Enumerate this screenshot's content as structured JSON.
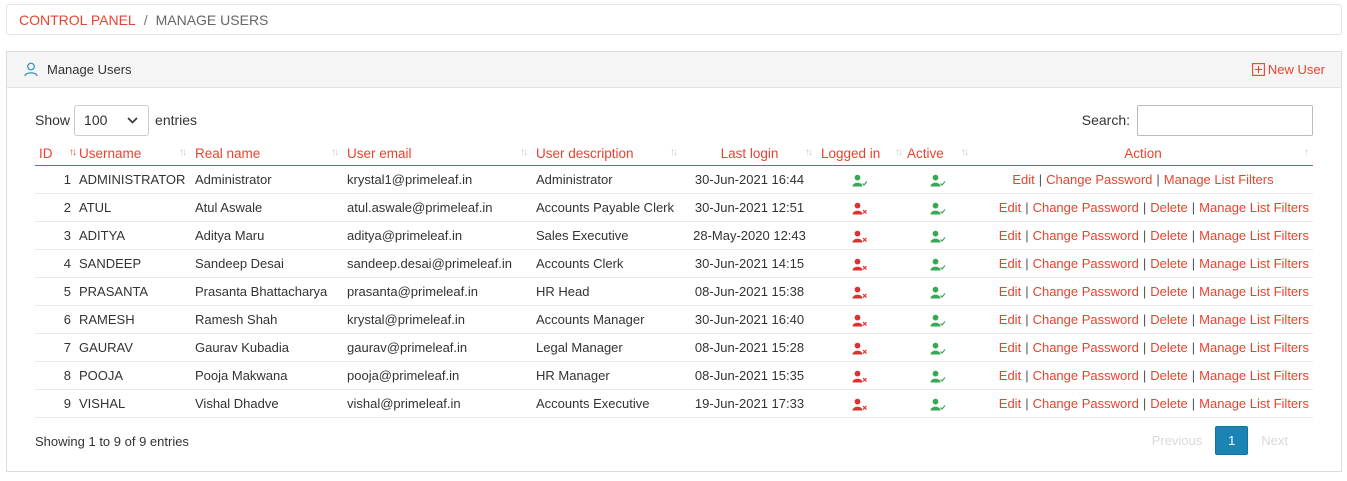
{
  "breadcrumb": {
    "root": "CONTROL PANEL",
    "separator": "/",
    "current": "MANAGE USERS"
  },
  "panel": {
    "title": "Manage Users",
    "new_user": "New User"
  },
  "controls": {
    "show": "Show",
    "entries_value": "100",
    "entries": "entries",
    "search": "Search:"
  },
  "columns": [
    "ID",
    "Username",
    "Real name",
    "User email",
    "User description",
    "Last login",
    "Logged in",
    "Active",
    "Action"
  ],
  "actions": {
    "edit": "Edit",
    "change_password": "Change Password",
    "delete": "Delete",
    "filters": "Manage List Filters",
    "sep": "|"
  },
  "rows": [
    {
      "id": "1",
      "username": "ADMINISTRATOR",
      "real_name": "Administrator",
      "email": "krystal1@primeleaf.in",
      "description": "Administrator",
      "last_login": "30-Jun-2021 16:44",
      "logged_in": true,
      "active": true
    },
    {
      "id": "2",
      "username": "ATUL",
      "real_name": "Atul Aswale",
      "email": "atul.aswale@primeleaf.in",
      "description": "Accounts Payable Clerk",
      "last_login": "30-Jun-2021 12:51",
      "logged_in": false,
      "active": true
    },
    {
      "id": "3",
      "username": "ADITYA",
      "real_name": "Aditya Maru",
      "email": "aditya@primeleaf.in",
      "description": "Sales Executive",
      "last_login": "28-May-2020 12:43",
      "logged_in": false,
      "active": true
    },
    {
      "id": "4",
      "username": "SANDEEP",
      "real_name": "Sandeep Desai",
      "email": "sandeep.desai@primeleaf.in",
      "description": "Accounts Clerk",
      "last_login": "30-Jun-2021 14:15",
      "logged_in": false,
      "active": true
    },
    {
      "id": "5",
      "username": "PRASANTA",
      "real_name": "Prasanta Bhattacharya",
      "email": "prasanta@primeleaf.in",
      "description": "HR Head",
      "last_login": "08-Jun-2021 15:38",
      "logged_in": false,
      "active": true
    },
    {
      "id": "6",
      "username": "RAMESH",
      "real_name": "Ramesh Shah",
      "email": "krystal@primeleaf.in",
      "description": "Accounts Manager",
      "last_login": "30-Jun-2021 16:40",
      "logged_in": false,
      "active": true
    },
    {
      "id": "7",
      "username": "GAURAV",
      "real_name": "Gaurav Kubadia",
      "email": "gaurav@primeleaf.in",
      "description": "Legal Manager",
      "last_login": "08-Jun-2021 15:28",
      "logged_in": false,
      "active": true
    },
    {
      "id": "8",
      "username": "POOJA",
      "real_name": "Pooja Makwana",
      "email": "pooja@primeleaf.in",
      "description": "HR Manager",
      "last_login": "08-Jun-2021 15:35",
      "logged_in": false,
      "active": true
    },
    {
      "id": "9",
      "username": "VISHAL",
      "real_name": "Vishal Dhadve",
      "email": "vishal@primeleaf.in",
      "description": "Accounts Executive",
      "last_login": "19-Jun-2021 17:33",
      "logged_in": false,
      "active": true
    }
  ],
  "footer": {
    "info": "Showing 1 to 9 of 9 entries",
    "previous": "Previous",
    "page": "1",
    "next": "Next"
  },
  "colors": {
    "accent": "#e8432e",
    "green": "#3aa655",
    "red": "#e02f2f",
    "pager": "#1b84b5"
  },
  "icons": {
    "panel": "user-outline-icon",
    "new_user": "plus-square-icon",
    "logged_in": "user-check-icon",
    "logged_out": "user-x-icon",
    "sort": "sort-arrows-icon"
  }
}
